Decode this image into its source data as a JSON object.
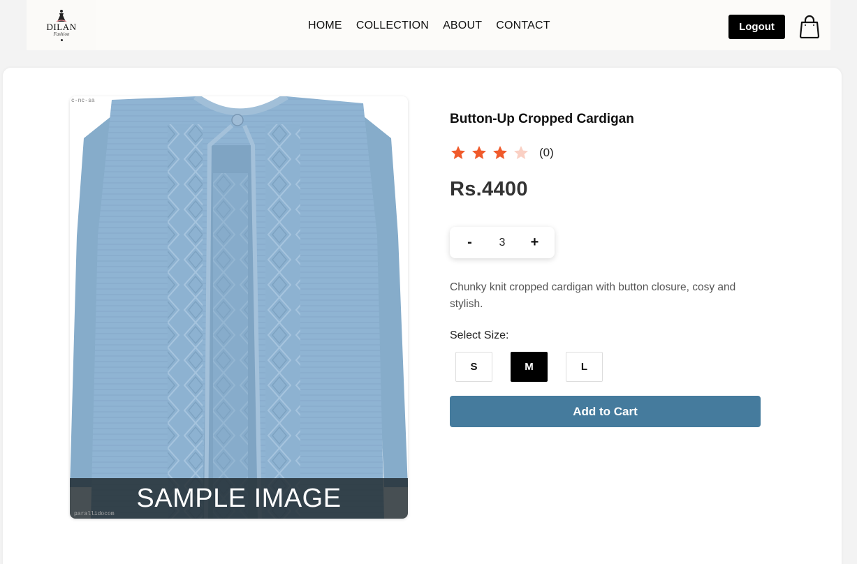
{
  "header": {
    "logo": {
      "name": "DILAN",
      "sub": "Fashion"
    },
    "nav": [
      "HOME",
      "COLLECTION",
      "ABOUT",
      "CONTACT"
    ],
    "logout_label": "Logout"
  },
  "product": {
    "title": "Button-Up Cropped Cardigan",
    "rating": {
      "filled": 3,
      "half_filled": 0,
      "total_stars": 4,
      "review_count": "(0)"
    },
    "price": "Rs.4400",
    "quantity": {
      "decrement_label": "-",
      "value": "3",
      "increment_label": "+"
    },
    "description": "Chunky knit cropped cardigan with button closure, cosy and stylish.",
    "size_label": "Select Size:",
    "sizes": [
      "S",
      "M",
      "L"
    ],
    "selected_size": "M",
    "add_to_cart_label": "Add to Cart",
    "image": {
      "banner_text": "SAMPLE IMAGE",
      "watermark_top": "c-nc-sa",
      "watermark_bottom": "parallidocom"
    }
  },
  "colors": {
    "accent": "#457b9d",
    "star_filled": "#f05a2b",
    "star_empty": "#fad0c4",
    "cardigan": "#8fb4d3"
  },
  "icons": {
    "cart": "shopping-bag-icon",
    "rating": "star-icon"
  }
}
